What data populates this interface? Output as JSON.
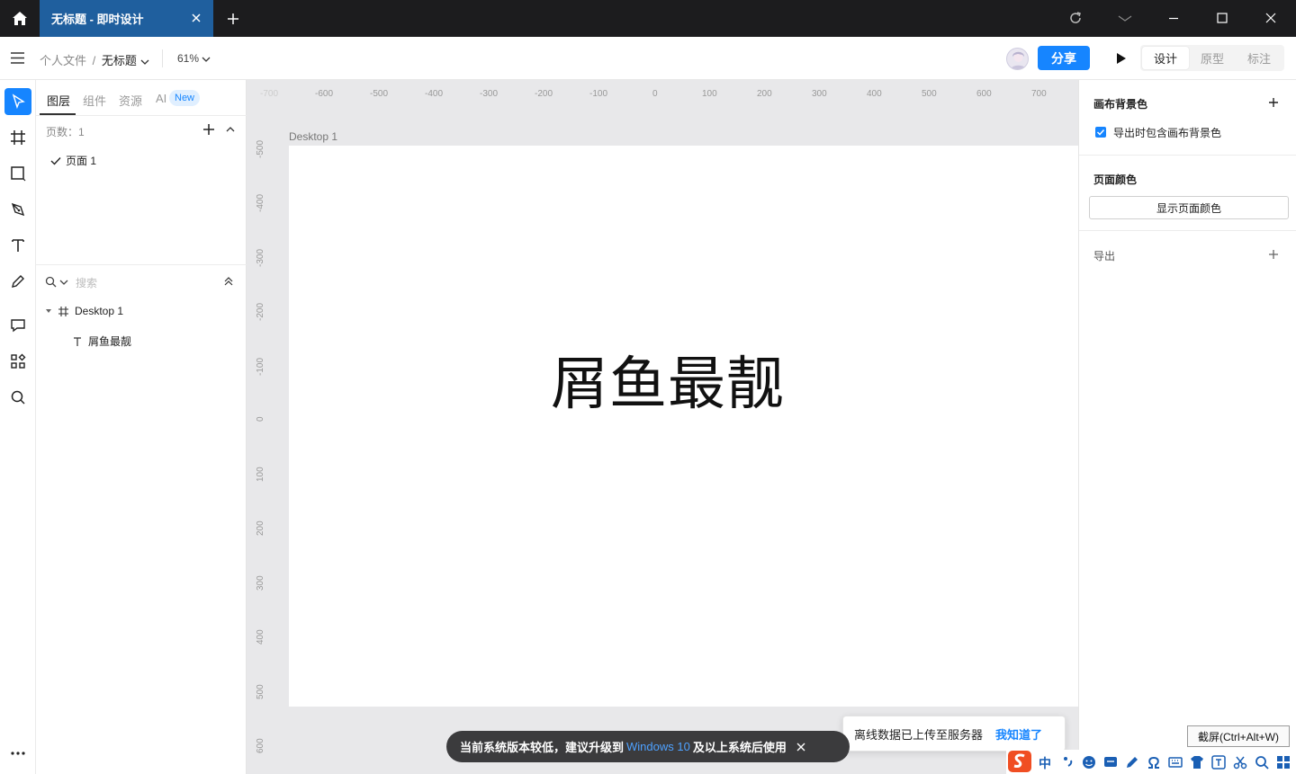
{
  "titlebar": {
    "tab_title": "无标题 - 即时设计",
    "icons": [
      "home-icon",
      "close-icon",
      "plus-icon",
      "refresh-icon",
      "chevron-down-icon",
      "minimize-icon",
      "maximize-icon",
      "close-icon"
    ]
  },
  "toolbar": {
    "breadcrumb_root": "个人文件",
    "breadcrumb_sep": "/",
    "breadcrumb_current": "无标题",
    "zoom": "61%",
    "share_label": "分享",
    "modes": [
      "设计",
      "原型",
      "标注"
    ],
    "active_mode": "设计"
  },
  "left_panel": {
    "tabs": [
      "图层",
      "组件",
      "资源",
      "AI"
    ],
    "new_badge": "New",
    "pages_count": "页数：1",
    "pages": [
      "页面 1"
    ],
    "search_placeholder": "搜索",
    "layers": [
      {
        "name": "Desktop 1",
        "type": "frame"
      },
      {
        "name": "屑鱼最靓",
        "type": "text"
      }
    ]
  },
  "canvas": {
    "ruler_x": [
      "-700",
      "-600",
      "-500",
      "-400",
      "-300",
      "-200",
      "-100",
      "0",
      "100",
      "200",
      "300",
      "400",
      "500",
      "600",
      "700"
    ],
    "ruler_y": [
      "-500",
      "-400",
      "-300",
      "-200",
      "-100",
      "0",
      "100",
      "200",
      "300",
      "400",
      "500",
      "600"
    ],
    "frame_name": "Desktop 1",
    "frame_text": "屑鱼最靓",
    "frame_bg": "#ffffff"
  },
  "right_panel": {
    "canvas_bg_title": "画布背景色",
    "export_bg_label": "导出时包含画布背景色",
    "export_bg_checked": true,
    "page_color_title": "页面颜色",
    "show_page_color_button": "显示页面颜色",
    "export_title": "导出"
  },
  "toasts": {
    "upgrade_prefix": "当前系统版本较低，建议升级到",
    "upgrade_highlight": "Windows 10",
    "upgrade_suffix": "及以上系统后使用",
    "offline_message": "离线数据已上传至服务器",
    "offline_ack": "我知道了"
  },
  "system": {
    "ime_lang": "中",
    "screenshot_tooltip": "截屏(Ctrl+Alt+W)"
  },
  "colors": {
    "accent": "#1685ff",
    "tab_active": "#1f5f9e",
    "titlebar": "#1c1c1e",
    "canvas": "#e8e8ea",
    "ime_brand": "#f04e23"
  }
}
